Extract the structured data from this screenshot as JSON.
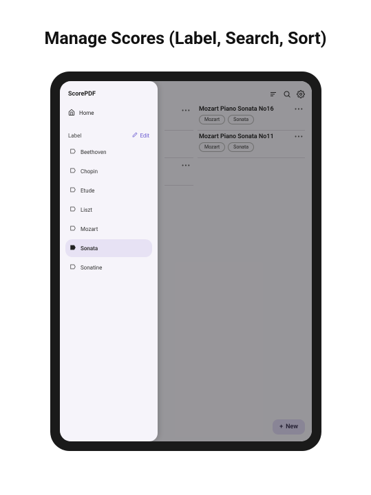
{
  "page_heading": "Manage Scores (Label, Search, Sort)",
  "app_name": "ScorePDF",
  "sidebar": {
    "home_label": "Home",
    "section_label": "Label",
    "edit_label": "Edit",
    "labels": [
      {
        "name": "Beethoven",
        "selected": false
      },
      {
        "name": "Chopin",
        "selected": false
      },
      {
        "name": "Etude",
        "selected": false
      },
      {
        "name": "Liszt",
        "selected": false
      },
      {
        "name": "Mozart",
        "selected": false
      },
      {
        "name": "Sonata",
        "selected": true
      },
      {
        "name": "Sonatine",
        "selected": false
      }
    ]
  },
  "scores": [
    {
      "title": "Mozart Piano Sonata No16",
      "tags": [
        "Mozart",
        "Sonata"
      ]
    },
    {
      "title": "Mozart Piano Sonata No11",
      "tags": [
        "Mozart",
        "Sonata"
      ]
    }
  ],
  "new_button_label": "New"
}
